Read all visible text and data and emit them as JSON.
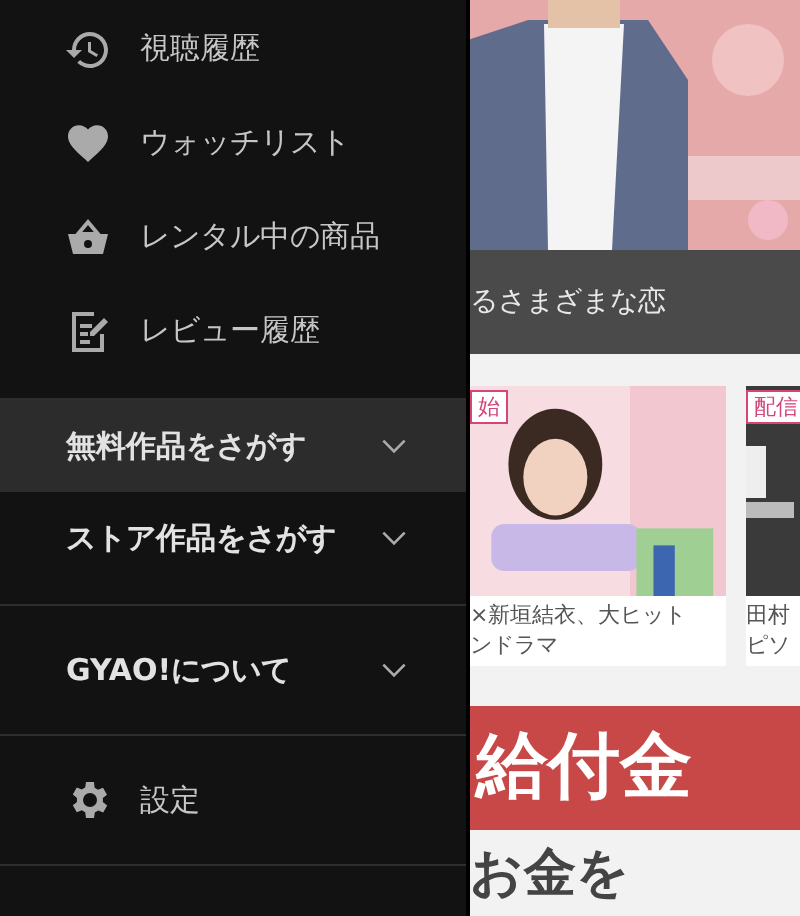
{
  "drawer": {
    "items": [
      {
        "label": "視聴履歴",
        "kind": "history"
      },
      {
        "label": "ウォッチリスト",
        "kind": "heart"
      },
      {
        "label": "レンタル中の商品",
        "kind": "basket"
      },
      {
        "label": "レビュー履歴",
        "kind": "review"
      }
    ],
    "sections": [
      {
        "label": "無料作品をさがす",
        "expanded": false,
        "selected": true
      },
      {
        "label": "ストア作品をさがす",
        "expanded": false,
        "selected": false
      },
      {
        "label": "GYAO!について",
        "expanded": false,
        "selected": false
      }
    ],
    "settings": {
      "label": "設定"
    }
  },
  "content": {
    "caption": "るさまざまな恋",
    "cards": [
      {
        "badge": "始",
        "lines": [
          "×新垣結衣、大ヒット",
          "ンドラマ"
        ],
        "kind": "light"
      },
      {
        "badge": "配信",
        "lines": [
          "田村",
          "ピソ"
        ],
        "kind": "dark"
      }
    ],
    "banner": "給付金",
    "headline": "お金を"
  }
}
